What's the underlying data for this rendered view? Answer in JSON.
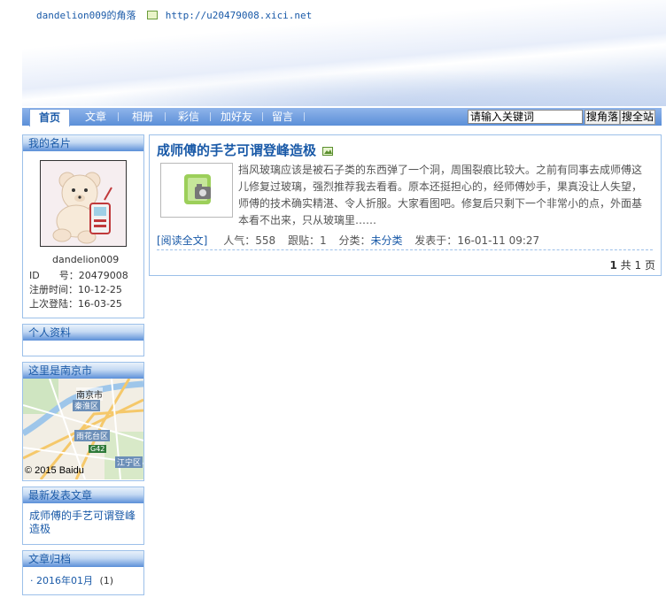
{
  "site": {
    "title": "dandelion009的角落",
    "url": "http://u20479008.xici.net"
  },
  "nav": {
    "items": [
      "首页",
      "文章",
      "相册",
      "彩信",
      "加好友",
      "留言"
    ],
    "search_placeholder": "请输入关键词",
    "search_blog_label": "搜角落",
    "search_site_label": "搜全站"
  },
  "sidebar": {
    "card_title": "我的名片",
    "username": "dandelion009",
    "id_line": "ID　　号：20479008",
    "registered_line": "注册时间：10-12-25",
    "last_login_line": "上次登陆：16-03-25",
    "profile_title": "个人资料",
    "location_title": "这里是南京市",
    "map": {
      "city_label": "南京市",
      "district1": "秦淮区",
      "district2": "雨花台区",
      "district3": "江宁区",
      "road": "G42",
      "credit": "© 2015 Baidu"
    },
    "recent_title": "最新发表文章",
    "recent_post": "成师傅的手艺可谓登峰造极",
    "archive_title": "文章归档",
    "archive_item": "· 2016年01月",
    "archive_count": "(1)"
  },
  "post": {
    "title": "成师傅的手艺可谓登峰造极",
    "excerpt": "挡风玻璃应该是被石子类的东西弹了一个洞，周围裂痕比较大。之前有同事去成师傅这儿修复过玻璃，强烈推荐我去看看。原本还挺担心的，经师傅妙手，果真没让人失望，师傅的技术确实精湛、令人折服。大家看图吧。修复后只剩下一个非常小的点，外面基本看不出来，只从玻璃里……",
    "read_more": "[阅读全文]",
    "views_label": "人气：",
    "views": "558",
    "replies_label": "跟贴：",
    "replies": "1",
    "category_label": "分类：",
    "category": "未分类",
    "posted_label": "发表于：",
    "posted": "16-01-11 09:27"
  },
  "pager": {
    "current": "1",
    "total_prefix": "共",
    "total": "1",
    "unit": "页"
  },
  "colors": {
    "accent": "#1a5aa8",
    "nav": "#5b8fd8",
    "border": "#9cc0e9"
  }
}
